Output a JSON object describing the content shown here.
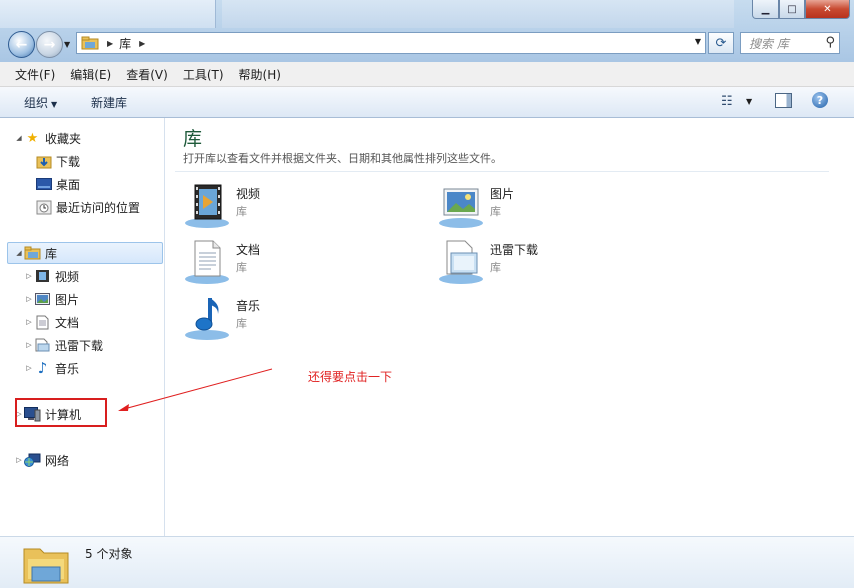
{
  "window": {
    "minimize": "▁",
    "maximize": "□",
    "close": "✕"
  },
  "address": {
    "crumbs": [
      "库"
    ],
    "search_placeholder": "搜索 库"
  },
  "menu": [
    "文件(F)",
    "编辑(E)",
    "查看(V)",
    "工具(T)",
    "帮助(H)"
  ],
  "commands": {
    "organize": "组织",
    "new_library": "新建库"
  },
  "nav": {
    "favorites": {
      "label": "收藏夹",
      "items": [
        "下载",
        "桌面",
        "最近访问的位置"
      ]
    },
    "libraries": {
      "label": "库",
      "items": [
        "视频",
        "图片",
        "文档",
        "迅雷下载",
        "音乐"
      ]
    },
    "computer": "计算机",
    "network": "网络"
  },
  "content": {
    "title": "库",
    "description": "打开库以查看文件并根据文件夹、日期和其他属性排列这些文件。",
    "tiles": [
      {
        "name": "视频",
        "sub": "库",
        "icon": "video-library-icon"
      },
      {
        "name": "图片",
        "sub": "库",
        "icon": "picture-library-icon"
      },
      {
        "name": "文档",
        "sub": "库",
        "icon": "document-library-icon"
      },
      {
        "name": "迅雷下载",
        "sub": "库",
        "icon": "download-library-icon"
      },
      {
        "name": "音乐",
        "sub": "库",
        "icon": "music-library-icon"
      }
    ]
  },
  "annotation": "还得要点击一下",
  "status": {
    "count": "5 个对象"
  },
  "colors": {
    "annotation": "#e02020",
    "selection": "#d5e7fb",
    "title": "#1e5a3a"
  }
}
